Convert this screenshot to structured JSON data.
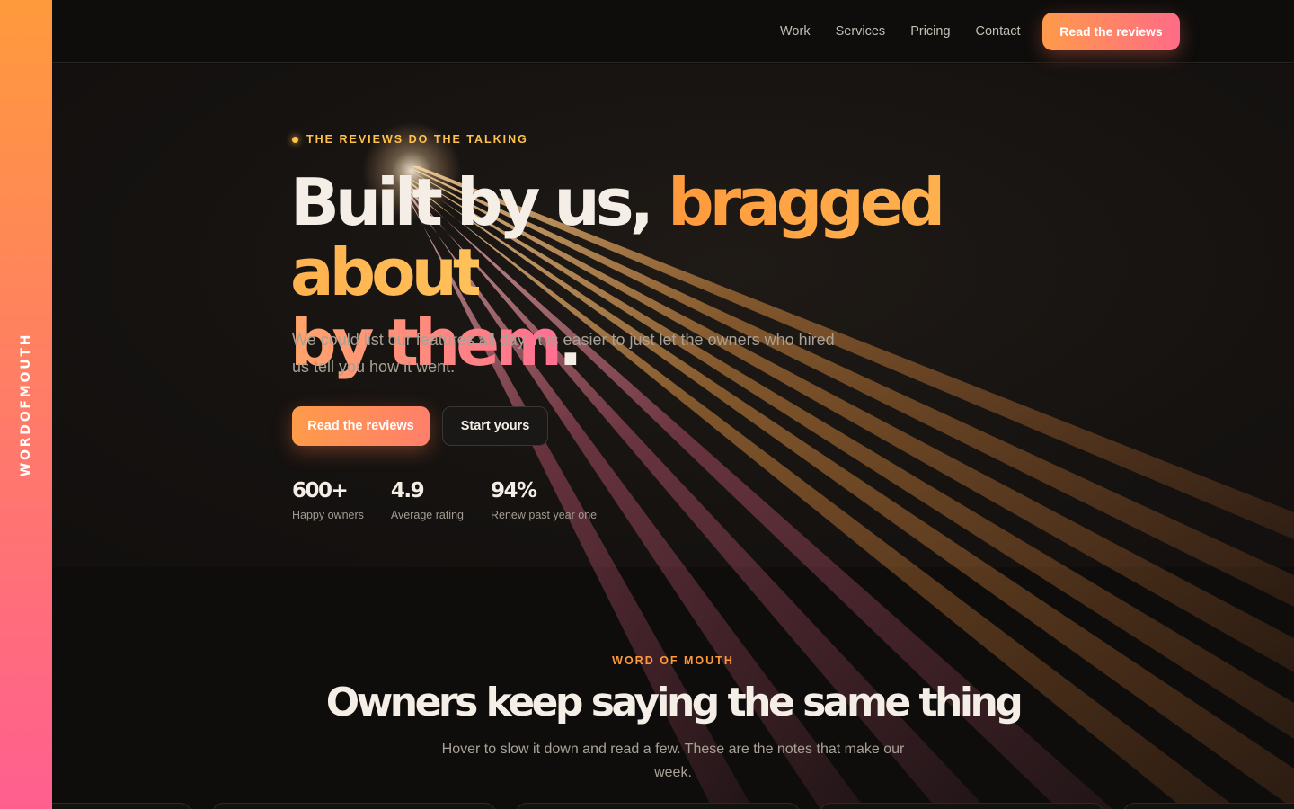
{
  "brand": {
    "name": "WORDOFMOUTH"
  },
  "nav": {
    "items": [
      "Work",
      "Services",
      "Pricing",
      "Contact"
    ],
    "cta_label": "Read the reviews"
  },
  "hero": {
    "eyebrow": "THE REVIEWS DO THE TALKING",
    "headline": {
      "plain_1": "Built by us, ",
      "accent_1": "bragged about",
      "accent_2": "by them",
      "period": "."
    },
    "lede": "We could list our features all day. It is easier to just let the owners who hired us tell you how it went.",
    "primary_cta": "Read the reviews",
    "secondary_cta": "Start yours",
    "stats": [
      {
        "value": "600+",
        "label": "Happy owners"
      },
      {
        "value": "4.9",
        "label": "Average rating"
      },
      {
        "value": "94%",
        "label": "Renew past year one"
      }
    ]
  },
  "reviews_section": {
    "eyebrow": "WORD OF MOUTH",
    "title": "Owners keep saying the same thing",
    "subtitle": "Hover to slow it down and read a few. These are the notes that make our week."
  },
  "colors": {
    "accent_orange": "#ff9a3c",
    "accent_pink": "#ff6f92",
    "accent_yellow": "#ffc24a",
    "background": "#0e0d0c"
  }
}
